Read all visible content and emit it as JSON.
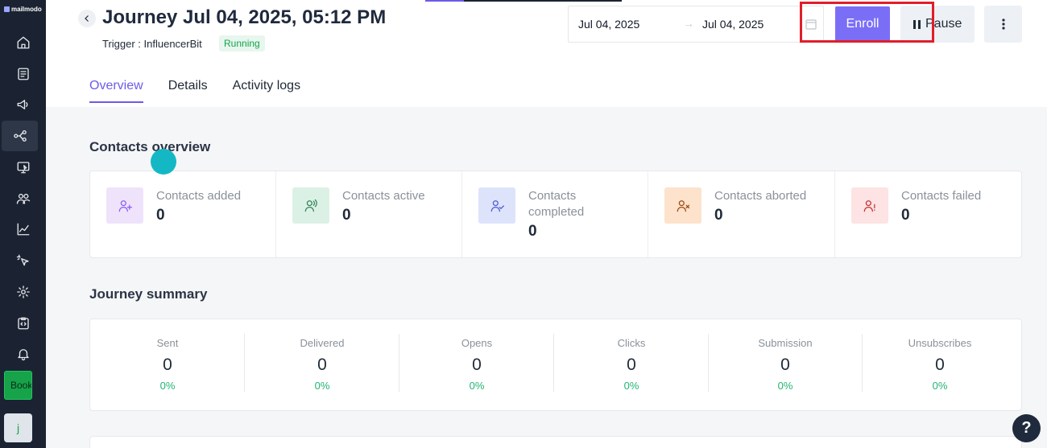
{
  "app": {
    "logo_text": "mailmodo"
  },
  "sidebar": {
    "items": [
      {
        "name": "home-icon"
      },
      {
        "name": "document-icon"
      },
      {
        "name": "megaphone-icon"
      },
      {
        "name": "journey-icon"
      },
      {
        "name": "monitor-icon"
      },
      {
        "name": "users-icon"
      },
      {
        "name": "chart-icon"
      },
      {
        "name": "cursor-click-icon"
      },
      {
        "name": "gear-icon"
      },
      {
        "name": "code-clipboard-icon"
      },
      {
        "name": "bell-icon"
      }
    ],
    "book_label": "Book",
    "avatar_initial": "j"
  },
  "header": {
    "title": "Journey Jul 04, 2025, 05:12 PM",
    "trigger_text": "Trigger : InfluencerBit",
    "status": "Running",
    "date_from": "Jul 04, 2025",
    "date_arrow": "→",
    "date_to": "Jul 04, 2025",
    "enroll_label": "Enroll",
    "pause_label": "Pause"
  },
  "tabs": [
    {
      "label": "Overview",
      "active": true
    },
    {
      "label": "Details",
      "active": false
    },
    {
      "label": "Activity logs",
      "active": false
    }
  ],
  "contacts_overview": {
    "title": "Contacts overview",
    "stats": [
      {
        "label": "Contacts added",
        "value": "0",
        "icon": "user-plus-icon",
        "bg": "#efe3fb",
        "stroke": "#8b5cf6"
      },
      {
        "label": "Contacts active",
        "value": "0",
        "icon": "user-active-icon",
        "bg": "#dcf1e5",
        "stroke": "#2f855a"
      },
      {
        "label": "Contacts completed",
        "value": "0",
        "icon": "user-check-icon",
        "bg": "#dde3fb",
        "stroke": "#4c5bd4"
      },
      {
        "label": "Contacts aborted",
        "value": "0",
        "icon": "user-x-icon",
        "bg": "#fde2cc",
        "stroke": "#9a4a12"
      },
      {
        "label": "Contacts failed",
        "value": "0",
        "icon": "user-alert-icon",
        "bg": "#fde3e3",
        "stroke": "#c53030"
      }
    ]
  },
  "journey_summary": {
    "title": "Journey summary",
    "metrics": [
      {
        "label": "Sent",
        "value": "0",
        "pct": "0%"
      },
      {
        "label": "Delivered",
        "value": "0",
        "pct": "0%"
      },
      {
        "label": "Opens",
        "value": "0",
        "pct": "0%"
      },
      {
        "label": "Clicks",
        "value": "0",
        "pct": "0%"
      },
      {
        "label": "Submission",
        "value": "0",
        "pct": "0%"
      },
      {
        "label": "Unsubscribes",
        "value": "0",
        "pct": "0%"
      }
    ]
  },
  "help_label": "?"
}
